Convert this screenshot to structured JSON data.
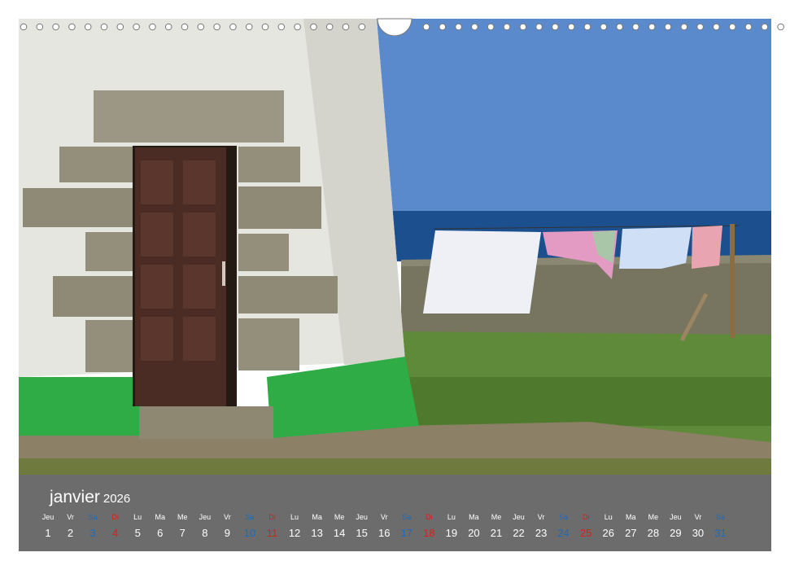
{
  "calendar": {
    "month": "janvier",
    "year": "2026",
    "colors": {
      "saturday": "#1e6bb8",
      "sunday": "#d62020",
      "bar": "#6c6c6c",
      "text": "#ffffff"
    },
    "days": [
      {
        "n": "Jeu",
        "d": "1",
        "t": "w"
      },
      {
        "n": "Vr",
        "d": "2",
        "t": "w"
      },
      {
        "n": "Sa",
        "d": "3",
        "t": "sat"
      },
      {
        "n": "Di",
        "d": "4",
        "t": "sun"
      },
      {
        "n": "Lu",
        "d": "5",
        "t": "w"
      },
      {
        "n": "Ma",
        "d": "6",
        "t": "w"
      },
      {
        "n": "Me",
        "d": "7",
        "t": "w"
      },
      {
        "n": "Jeu",
        "d": "8",
        "t": "w"
      },
      {
        "n": "Vr",
        "d": "9",
        "t": "w"
      },
      {
        "n": "Sa",
        "d": "10",
        "t": "sat"
      },
      {
        "n": "Di",
        "d": "11",
        "t": "sun"
      },
      {
        "n": "Lu",
        "d": "12",
        "t": "w"
      },
      {
        "n": "Ma",
        "d": "13",
        "t": "w"
      },
      {
        "n": "Me",
        "d": "14",
        "t": "w"
      },
      {
        "n": "Jeu",
        "d": "15",
        "t": "w"
      },
      {
        "n": "Vr",
        "d": "16",
        "t": "w"
      },
      {
        "n": "Sa",
        "d": "17",
        "t": "sat"
      },
      {
        "n": "Di",
        "d": "18",
        "t": "sun"
      },
      {
        "n": "Lu",
        "d": "19",
        "t": "w"
      },
      {
        "n": "Ma",
        "d": "20",
        "t": "w"
      },
      {
        "n": "Me",
        "d": "21",
        "t": "w"
      },
      {
        "n": "Jeu",
        "d": "22",
        "t": "w"
      },
      {
        "n": "Vr",
        "d": "23",
        "t": "w"
      },
      {
        "n": "Sa",
        "d": "24",
        "t": "sat"
      },
      {
        "n": "Di",
        "d": "25",
        "t": "sun"
      },
      {
        "n": "Lu",
        "d": "26",
        "t": "w"
      },
      {
        "n": "Ma",
        "d": "27",
        "t": "w"
      },
      {
        "n": "Me",
        "d": "28",
        "t": "w"
      },
      {
        "n": "Jeu",
        "d": "29",
        "t": "w"
      },
      {
        "n": "Vr",
        "d": "30",
        "t": "w"
      },
      {
        "n": "Sa",
        "d": "31",
        "t": "sat"
      }
    ]
  }
}
